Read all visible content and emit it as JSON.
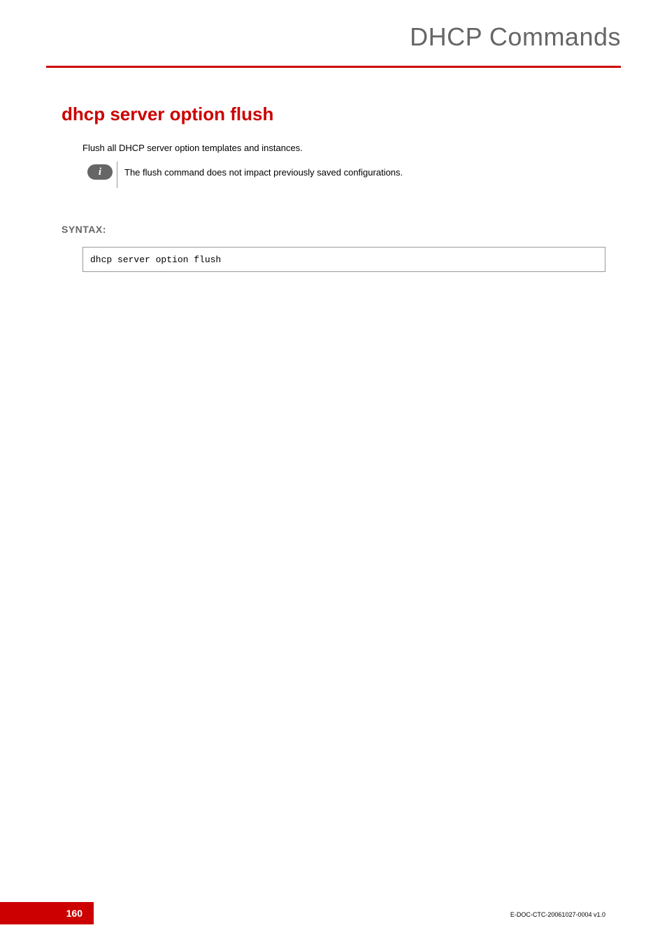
{
  "header": {
    "title": "DHCP Commands"
  },
  "command": {
    "title": "dhcp server option flush",
    "description": "Flush all DHCP server option templates and instances.",
    "infoNote": "The flush command does not impact previously saved configurations."
  },
  "syntax": {
    "label": "SYNTAX:",
    "code": "dhcp server option flush"
  },
  "footer": {
    "pageNumber": "160",
    "docId": "E-DOC-CTC-20061027-0004 v1.0"
  }
}
